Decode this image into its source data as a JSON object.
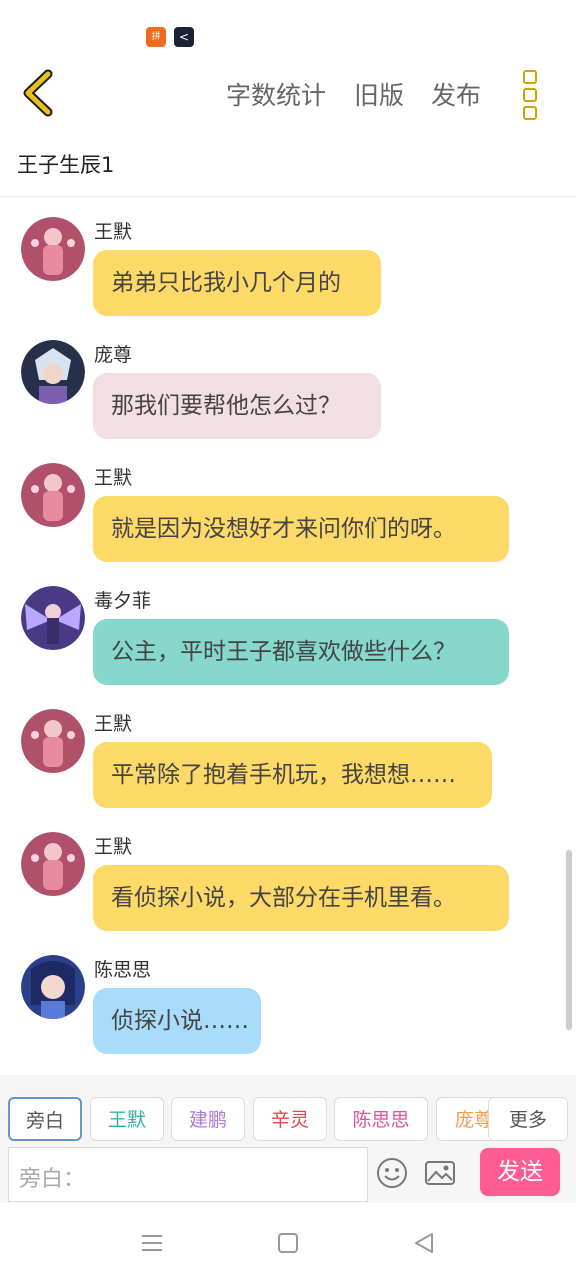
{
  "status_icons": [
    {
      "icon": "pdd-app-icon",
      "text": "拼"
    },
    {
      "icon": "back-chevron-app-icon",
      "text": "<"
    }
  ],
  "toolbar": {
    "back_icon": "chevron-left-icon",
    "word_count": "字数统计",
    "old_version": "旧版",
    "publish": "发布",
    "more_icon": "vertical-dots-icon"
  },
  "chapter_title": "王子生辰1",
  "messages": [
    {
      "name": "王默",
      "text": "弟弟只比我小几个月的",
      "color": "#fdd968"
    },
    {
      "name": "庞尊",
      "text": "那我们要帮他怎么过？",
      "color": "#f2dfe1"
    },
    {
      "name": "王默",
      "text": "就是因为没想好才来问你们的呀。",
      "color": "#fdd968"
    },
    {
      "name": "毒夕菲",
      "text": "公主，平时王子都喜欢做些什么？",
      "color": "#86d8cc"
    },
    {
      "name": "王默",
      "text": "平常除了抱着手机玩，我想想……",
      "color": "#fdd968"
    },
    {
      "name": "王默",
      "text": "看侦探小说，大部分在手机里看。",
      "color": "#fdd968"
    },
    {
      "name": "陈思思",
      "text": "侦探小说……",
      "color": "#a7dcfb"
    }
  ],
  "role_chips": [
    {
      "label": "旁白",
      "color": "#555555"
    },
    {
      "label": "王默",
      "color": "#2fb3a6"
    },
    {
      "label": "建鹏",
      "color": "#b07ad6"
    },
    {
      "label": "辛灵",
      "color": "#e04a4a"
    },
    {
      "label": "陈思思",
      "color": "#e0559a"
    },
    {
      "label": "庞尊",
      "color": "#f0a050"
    }
  ],
  "more_label": "更多",
  "input_placeholder": "旁白：",
  "send_label": "发送",
  "nav": {
    "menu": "menu-icon",
    "home": "home-square-icon",
    "back": "back-triangle-icon"
  }
}
